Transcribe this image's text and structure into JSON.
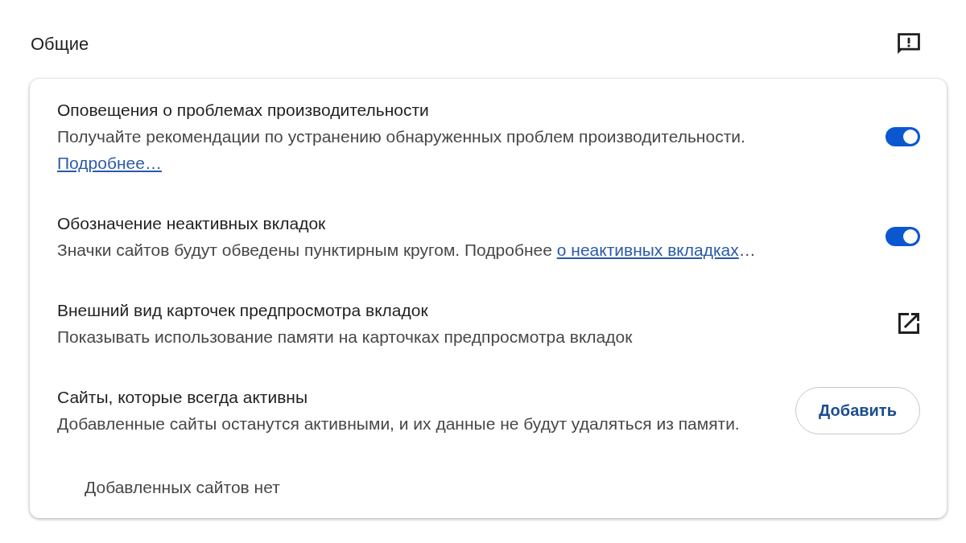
{
  "section": {
    "title": "Общие"
  },
  "settings": [
    {
      "kind": "toggle",
      "title": "Оповещения о проблемах производительности",
      "description": "Получайте рекомендации по устранению обнаруженных проблем производительности.",
      "link": "Подробнее…",
      "on": true
    },
    {
      "kind": "toggle",
      "title": "Обозначение неактивных вкладок",
      "description": "Значки сайтов будут обведены пунктирным кругом. Подробнее",
      "inline_link": "о неактивных вкладках",
      "after_link": "…",
      "on": true
    },
    {
      "kind": "external",
      "title": "Внешний вид карточек предпросмотра вкладок",
      "description": "Показывать использование памяти на карточках предпросмотра вкладок"
    },
    {
      "kind": "button",
      "title": "Сайты, которые всегда активны",
      "description": "Добавленные сайты останутся активными, и их данные не будут удаляться из памяти.",
      "button": "Добавить"
    }
  ],
  "empty_message": "Добавленных сайтов нет"
}
